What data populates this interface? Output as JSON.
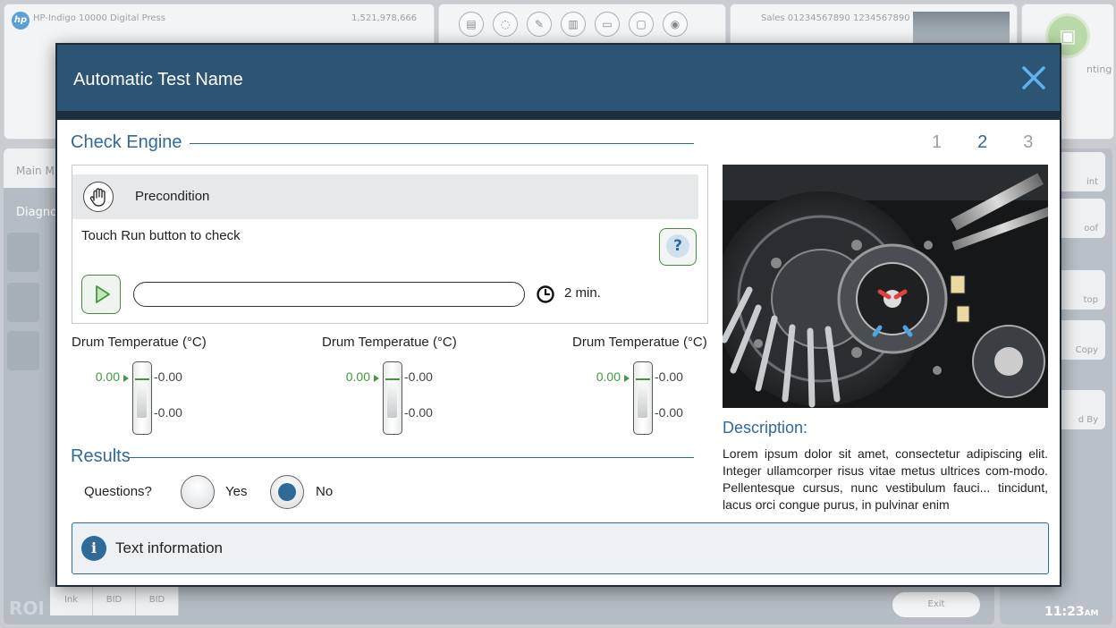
{
  "background": {
    "press_name": "HP-Indigo 10000 Digital Press",
    "impressions": "1,521,978,666",
    "sales_id": "Sales 01234567890 1234567890",
    "right_panel_label": "nting",
    "main_tab": "Main M",
    "diagnostics_tab": "Diagno",
    "bottom_tabs": [
      "Ink",
      "BID",
      "BID"
    ],
    "exit_label": "Exit",
    "right_buttons": [
      "int",
      "oof",
      "top",
      "Copy",
      "d By"
    ],
    "clock": "11:23",
    "clock_ampm": "AM",
    "roi": "ROI",
    "tool_icons": [
      "sheet-stack-icon",
      "blanket-icon",
      "brush-icon",
      "document-icon",
      "chat-icon",
      "monitor-icon",
      "target-icon"
    ]
  },
  "dialog": {
    "title": "Automatic Test Name",
    "close_icon": "close-icon",
    "section_title": "Check Engine",
    "steps": [
      "1",
      "2",
      "3"
    ],
    "active_step": 2,
    "precondition": {
      "label": "Precondition",
      "icon": "hand-icon"
    },
    "instruction": "Touch Run button to check",
    "help_label": "?",
    "run": {
      "icon": "play-icon",
      "progress": 0,
      "duration": "2 min."
    },
    "gauges": [
      {
        "title": "Drum Temperatue (°C)",
        "value": "0.00",
        "tick_top": "-0.00",
        "tick_bottom": "-0.00"
      },
      {
        "title": "Drum Temperatue (°C)",
        "value": "0.00",
        "tick_top": "-0.00",
        "tick_bottom": "-0.00"
      },
      {
        "title": "Drum Temperatue (°C)",
        "value": "0.00",
        "tick_top": "-0.00",
        "tick_bottom": "-0.00"
      }
    ],
    "results": {
      "title": "Results",
      "question": "Questions?",
      "options": [
        {
          "label": "Yes",
          "checked": false
        },
        {
          "label": "No",
          "checked": true
        }
      ]
    },
    "description": {
      "title": "Description:",
      "body": "Lorem ipsum dolor sit amet, consectetur adipiscing elit. Integer ullamcorper risus vitae metus ultrices com-modo. Pellentesque cursus, nunc vestibulum fauci... tincidunt, lacus orci congue purus, in pulvinar enim"
    },
    "info": {
      "icon": "info-icon",
      "text": "Text information"
    }
  },
  "colors": {
    "header": "#2c5475",
    "accent": "#2f6a98",
    "success": "#3f9a3b"
  }
}
